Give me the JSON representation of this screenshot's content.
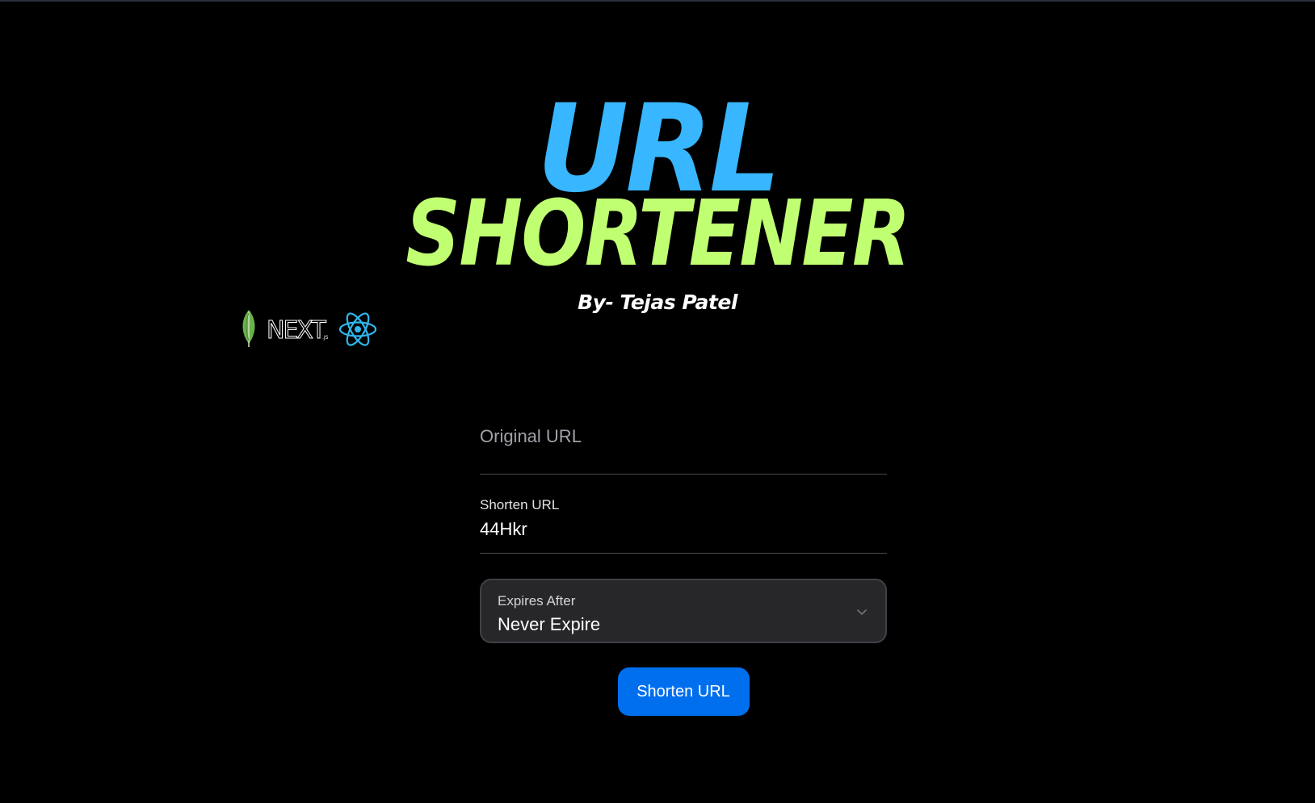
{
  "header": {
    "title_line1": "URL",
    "title_line2": "SHORTENER",
    "byline": "By- Tejas Patel"
  },
  "logos": {
    "items": [
      "mongodb-leaf-icon",
      "nextjs-logo",
      "react-icon"
    ],
    "nextjs_text": "NEXT",
    "nextjs_suffix": ".JS"
  },
  "form": {
    "original_url": {
      "placeholder": "Original URL",
      "value": ""
    },
    "shorten_url": {
      "label": "Shorten URL",
      "value": "44Hkr"
    },
    "expires": {
      "label": "Expires After",
      "selected": "Never Expire"
    },
    "submit_label": "Shorten URL"
  },
  "colors": {
    "background": "#000000",
    "title_url": "#38b6ff",
    "title_shortener": "#c1ff72",
    "button": "#006fee",
    "react": "#2fb8ec",
    "mongodb": "#6ab04c"
  }
}
